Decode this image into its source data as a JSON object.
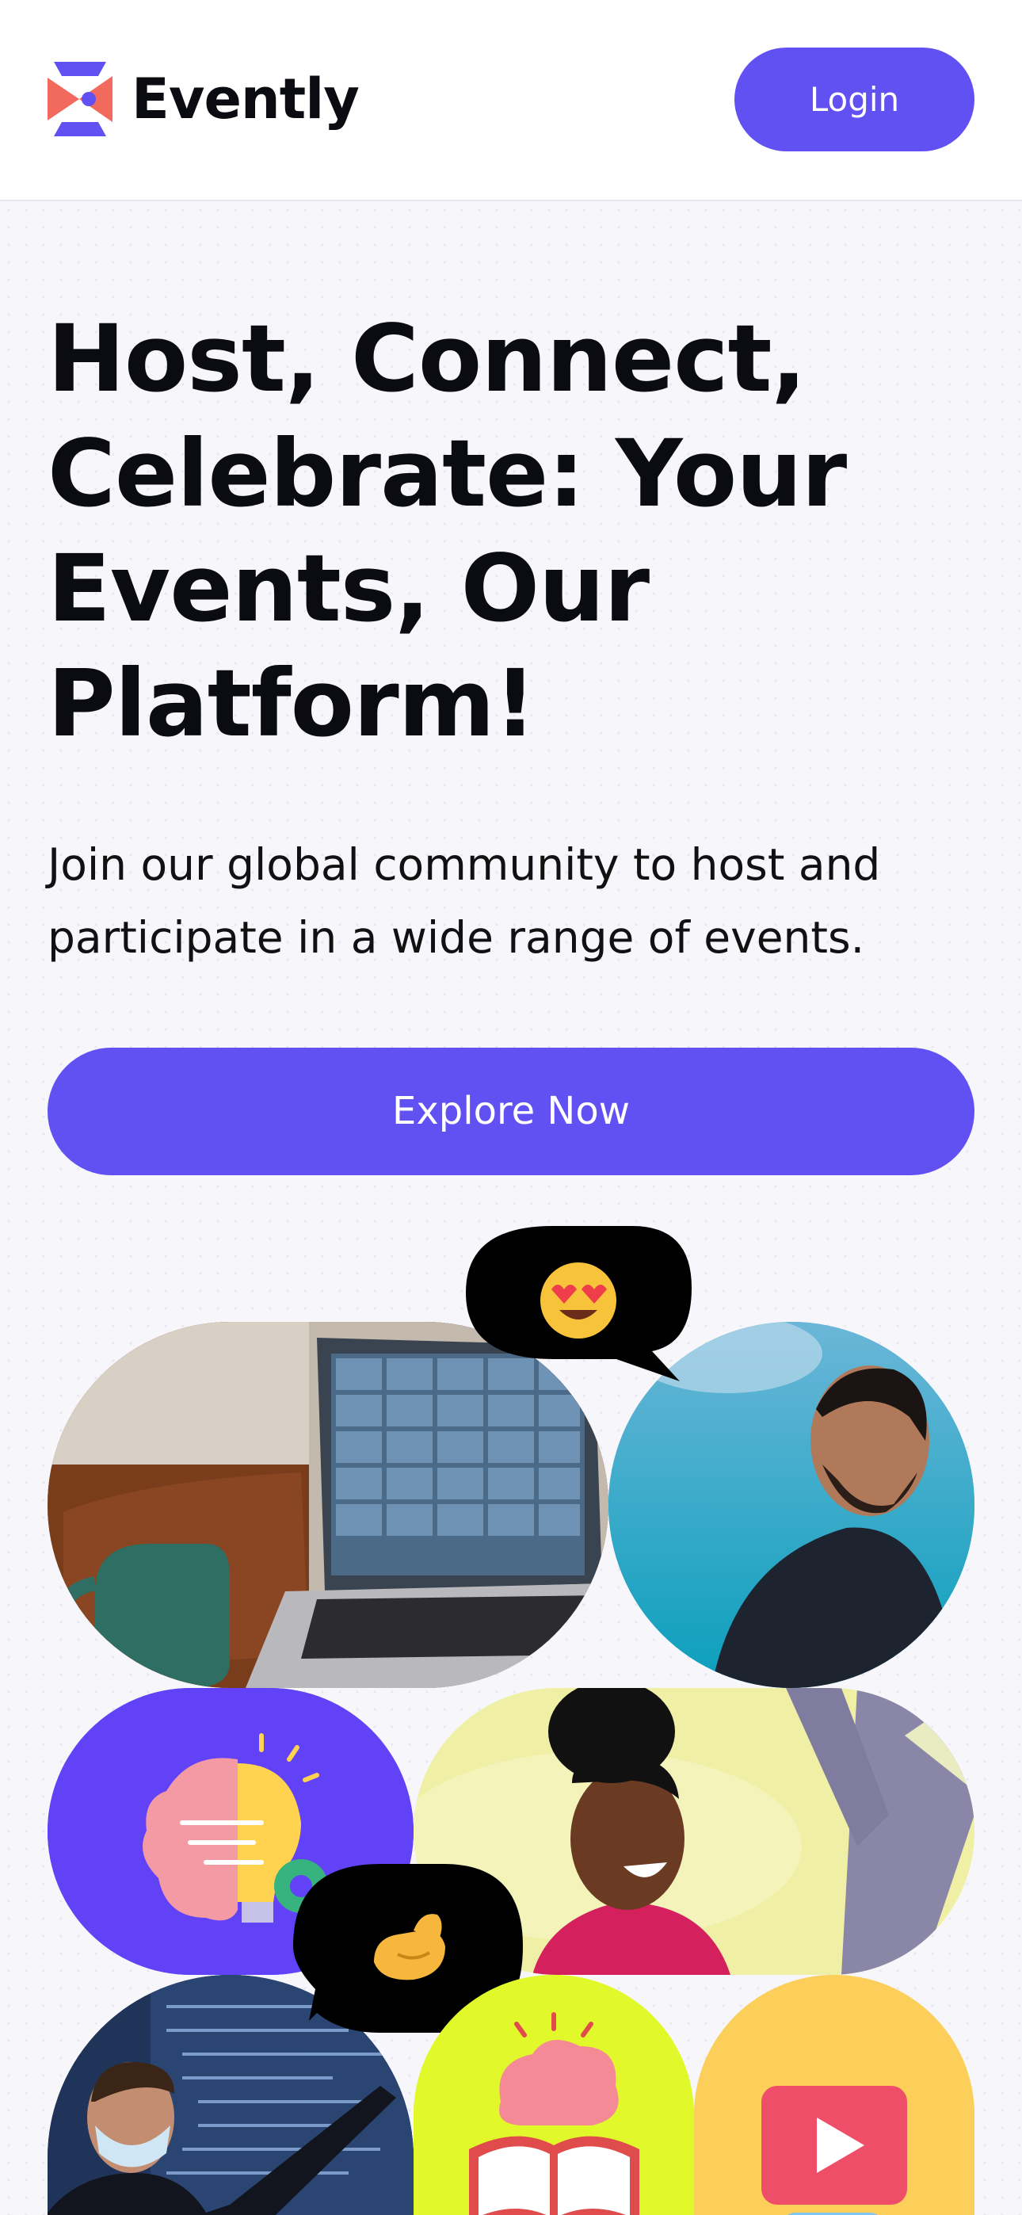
{
  "header": {
    "brand": "Evently",
    "login_label": "Login"
  },
  "hero": {
    "title": "Host, Connect, Celebrate: Your Events, Our Platform!",
    "subtitle": "Join our global community to host and participate in a wide range of events.",
    "cta_label": "Explore Now"
  },
  "colors": {
    "accent": "#6151f3",
    "logo_coral": "#f26a5d",
    "background": "#f6f6fb"
  },
  "gallery": {
    "bubble_top_emoji": "heart-eyes-emoji",
    "bubble_bottom_emoji": "pinched-fingers-emoji",
    "tiles": [
      "video-call-laptop-photo",
      "laughing-man-photo",
      "idea-brain-bulb-tile",
      "smiling-woman-photo",
      "developer-presenting-photo",
      "reading-brain-tile",
      "video-play-tile"
    ]
  }
}
